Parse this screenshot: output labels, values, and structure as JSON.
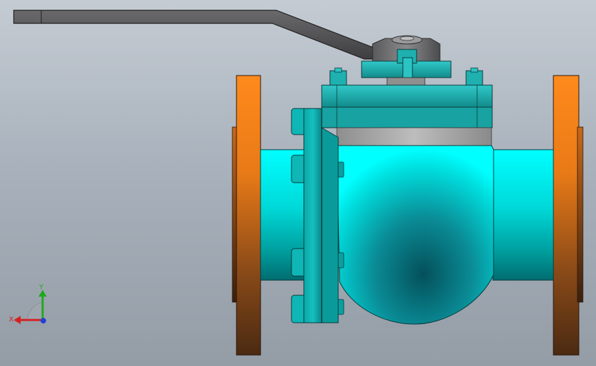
{
  "viewport": {
    "background_top": "#c4cbd3",
    "background_bottom": "#949ca6"
  },
  "model": {
    "parts": [
      {
        "name": "lever-handle",
        "color": "#58585a"
      },
      {
        "name": "stem-nut",
        "color": "#7a7a7c"
      },
      {
        "name": "gland-flange",
        "color": "#22b5b5"
      },
      {
        "name": "bonnet",
        "color": "#1fa8a8"
      },
      {
        "name": "body-neck",
        "color": "#a6a6a6"
      },
      {
        "name": "valve-body",
        "color": "#00e6e6"
      },
      {
        "name": "end-pipe-left",
        "color": "#00f2f2"
      },
      {
        "name": "end-pipe-right",
        "color": "#00f2f2"
      },
      {
        "name": "end-flange-left",
        "color": "#e87a17"
      },
      {
        "name": "end-flange-right",
        "color": "#e87a17"
      },
      {
        "name": "body-flange-bolts",
        "color": "#10b8b8"
      }
    ]
  },
  "triad": {
    "x_label": "X",
    "y_label": "Y",
    "x_color": "#d42020",
    "y_color": "#1fa81f",
    "z_color": "#2040d8"
  }
}
